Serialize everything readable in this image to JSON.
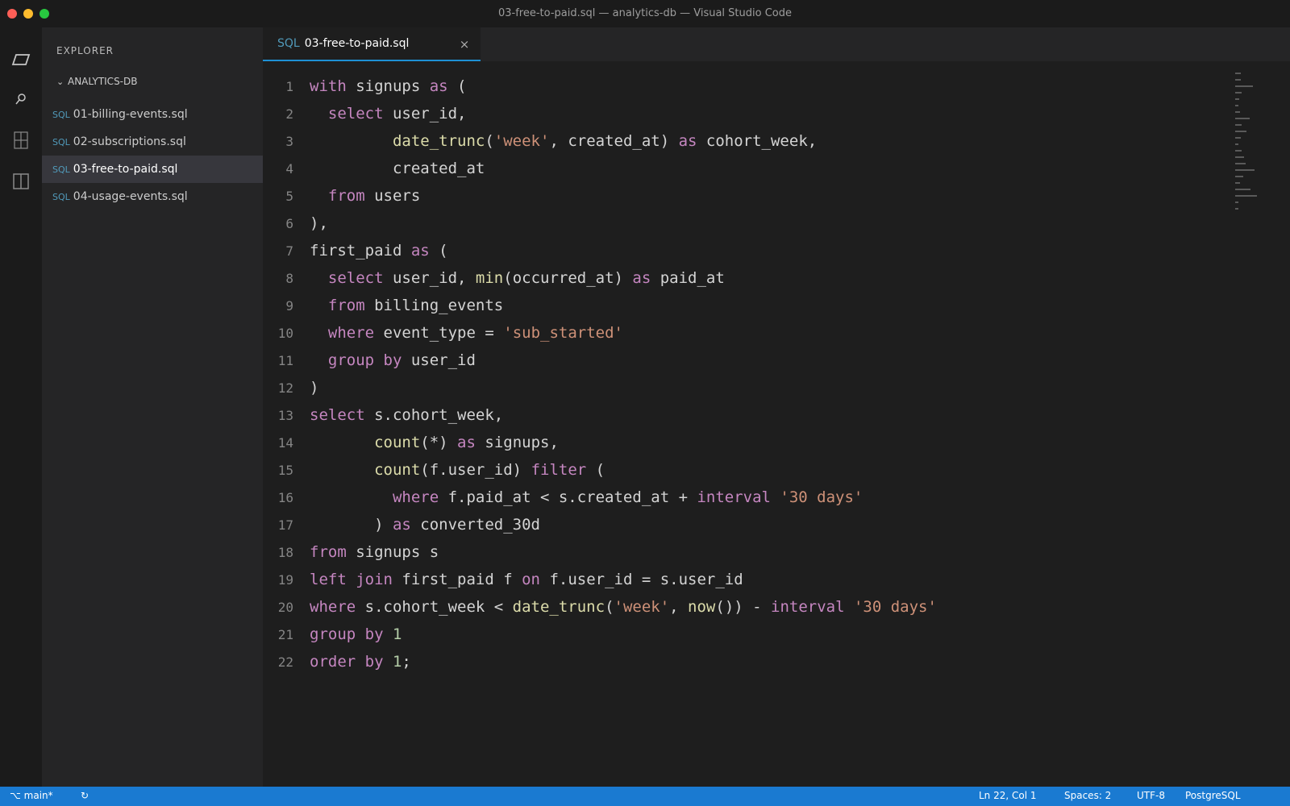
{
  "window": {
    "title": "03-free-to-paid.sql — analytics-db — Visual Studio Code"
  },
  "activity_bar": {
    "icons": [
      "files-icon",
      "search-icon",
      "source-control-icon",
      "extensions-icon"
    ]
  },
  "sidebar": {
    "title": "EXPLORER",
    "folder": "ANALYTICS-DB",
    "files": [
      {
        "tag": "SQL",
        "name": "01-billing-events.sql",
        "active": false
      },
      {
        "tag": "SQL",
        "name": "02-subscriptions.sql",
        "active": false
      },
      {
        "tag": "SQL",
        "name": "03-free-to-paid.sql",
        "active": true
      },
      {
        "tag": "SQL",
        "name": "04-usage-events.sql",
        "active": false
      }
    ]
  },
  "tab": {
    "tag": "SQL",
    "name": "03-free-to-paid.sql",
    "close": "×"
  },
  "editor": {
    "lines": [
      {
        "n": "1",
        "tokens": [
          [
            "kw",
            "with"
          ],
          [
            "t",
            " signups "
          ],
          [
            "kw",
            "as"
          ],
          [
            "t",
            " ("
          ]
        ]
      },
      {
        "n": "2",
        "tokens": [
          [
            "t",
            "  "
          ],
          [
            "kw",
            "select"
          ],
          [
            "t",
            " user_id,"
          ]
        ]
      },
      {
        "n": "3",
        "tokens": [
          [
            "t",
            "         "
          ],
          [
            "fn",
            "date_trunc"
          ],
          [
            "t",
            "("
          ],
          [
            "str",
            "'week'"
          ],
          [
            "t",
            ", created_at) "
          ],
          [
            "kw",
            "as"
          ],
          [
            "t",
            " cohort_week,"
          ]
        ]
      },
      {
        "n": "4",
        "tokens": [
          [
            "t",
            "         created_at"
          ]
        ]
      },
      {
        "n": "5",
        "tokens": [
          [
            "t",
            "  "
          ],
          [
            "kw",
            "from"
          ],
          [
            "t",
            " users"
          ]
        ]
      },
      {
        "n": "6",
        "tokens": [
          [
            "t",
            "),"
          ]
        ]
      },
      {
        "n": "7",
        "tokens": [
          [
            "t",
            "first_paid "
          ],
          [
            "kw",
            "as"
          ],
          [
            "t",
            " ("
          ]
        ]
      },
      {
        "n": "8",
        "tokens": [
          [
            "t",
            "  "
          ],
          [
            "kw",
            "select"
          ],
          [
            "t",
            " user_id, "
          ],
          [
            "fn",
            "min"
          ],
          [
            "t",
            "(occurred_at) "
          ],
          [
            "kw",
            "as"
          ],
          [
            "t",
            " paid_at"
          ]
        ]
      },
      {
        "n": "9",
        "tokens": [
          [
            "t",
            "  "
          ],
          [
            "kw",
            "from"
          ],
          [
            "t",
            " billing_events"
          ]
        ]
      },
      {
        "n": "10",
        "tokens": [
          [
            "t",
            "  "
          ],
          [
            "kw",
            "where"
          ],
          [
            "t",
            " event_type = "
          ],
          [
            "str",
            "'sub_started'"
          ]
        ]
      },
      {
        "n": "11",
        "tokens": [
          [
            "t",
            "  "
          ],
          [
            "kw",
            "group by"
          ],
          [
            "t",
            " user_id"
          ]
        ]
      },
      {
        "n": "12",
        "tokens": [
          [
            "t",
            ")"
          ]
        ]
      },
      {
        "n": "13",
        "tokens": [
          [
            "kw",
            "select"
          ],
          [
            "t",
            " s.cohort_week,"
          ]
        ]
      },
      {
        "n": "14",
        "tokens": [
          [
            "t",
            "       "
          ],
          [
            "fn",
            "count"
          ],
          [
            "t",
            "(*) "
          ],
          [
            "kw",
            "as"
          ],
          [
            "t",
            " signups,"
          ]
        ]
      },
      {
        "n": "15",
        "tokens": [
          [
            "t",
            "       "
          ],
          [
            "fn",
            "count"
          ],
          [
            "t",
            "(f.user_id) "
          ],
          [
            "kw",
            "filter"
          ],
          [
            "t",
            " ("
          ]
        ]
      },
      {
        "n": "16",
        "tokens": [
          [
            "t",
            "         "
          ],
          [
            "kw",
            "where"
          ],
          [
            "t",
            " f.paid_at < s.created_at + "
          ],
          [
            "kw",
            "interval"
          ],
          [
            "t",
            " "
          ],
          [
            "str",
            "'30 days'"
          ]
        ]
      },
      {
        "n": "17",
        "tokens": [
          [
            "t",
            "       ) "
          ],
          [
            "kw",
            "as"
          ],
          [
            "t",
            " converted_30d"
          ]
        ]
      },
      {
        "n": "18",
        "tokens": [
          [
            "kw",
            "from"
          ],
          [
            "t",
            " signups s"
          ]
        ]
      },
      {
        "n": "19",
        "tokens": [
          [
            "kw",
            "left join"
          ],
          [
            "t",
            " first_paid f "
          ],
          [
            "kw",
            "on"
          ],
          [
            "t",
            " f.user_id = s.user_id"
          ]
        ]
      },
      {
        "n": "20",
        "tokens": [
          [
            "kw",
            "where"
          ],
          [
            "t",
            " s.cohort_week < "
          ],
          [
            "fn",
            "date_trunc"
          ],
          [
            "t",
            "("
          ],
          [
            "str",
            "'week'"
          ],
          [
            "t",
            ", "
          ],
          [
            "fn",
            "now"
          ],
          [
            "t",
            "()) - "
          ],
          [
            "kw",
            "interval"
          ],
          [
            "t",
            " "
          ],
          [
            "str",
            "'30 days'"
          ]
        ]
      },
      {
        "n": "21",
        "tokens": [
          [
            "kw",
            "group by"
          ],
          [
            "t",
            " "
          ],
          [
            "num",
            "1"
          ]
        ]
      },
      {
        "n": "22",
        "tokens": [
          [
            "kw",
            "order by"
          ],
          [
            "t",
            " "
          ],
          [
            "num",
            "1"
          ],
          [
            "t",
            ";"
          ]
        ]
      }
    ]
  },
  "status_bar": {
    "branch": "main*",
    "sync": "↻",
    "cursor": "Ln 22, Col 1",
    "spaces": "Spaces: 2",
    "encoding": "UTF-8",
    "language": "PostgreSQL"
  },
  "colors": {
    "keyword": "#c586c0",
    "string": "#ce9178",
    "function": "#dcdcaa",
    "number": "#b5cea8",
    "statusbar": "#1a7ad1",
    "tab_accent": "#1e90d4"
  }
}
